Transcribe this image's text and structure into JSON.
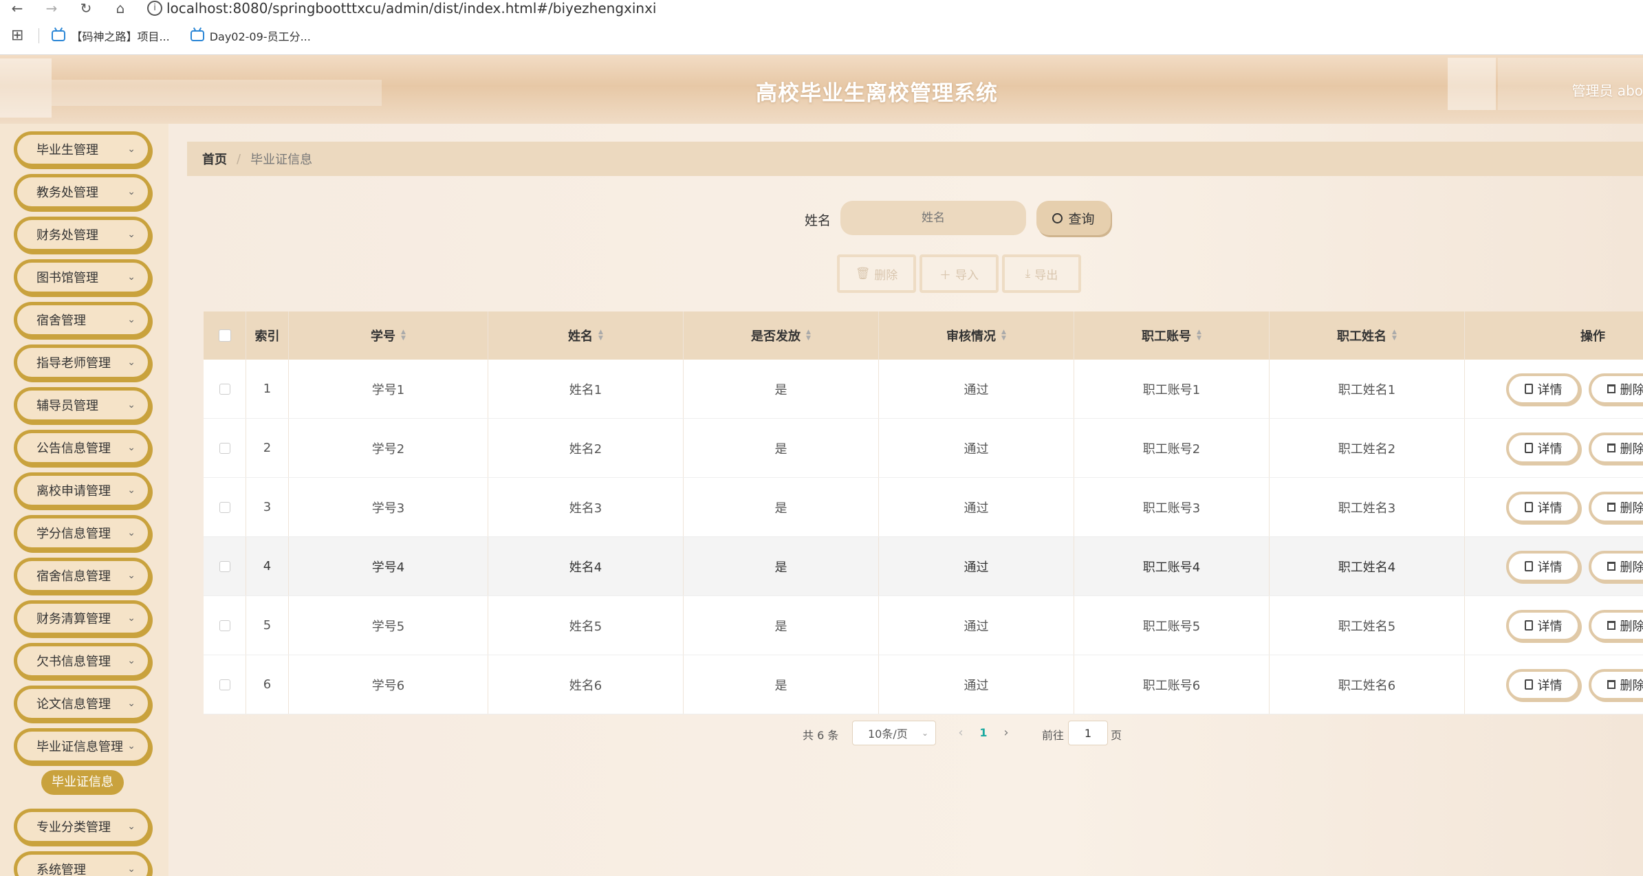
{
  "browser": {
    "url": "localhost:8080/springbootttxcu/admin/dist/index.html#/biyezhengxinxi",
    "bookmarks": [
      "【码神之路】项目...",
      "Day02-09-员工分..."
    ]
  },
  "header": {
    "title": "高校毕业生离校管理系统",
    "admin": "管理员 abo"
  },
  "sidebar": {
    "items": [
      {
        "label": "毕业生管理"
      },
      {
        "label": "教务处管理"
      },
      {
        "label": "财务处管理"
      },
      {
        "label": "图书馆管理"
      },
      {
        "label": "宿舍管理"
      },
      {
        "label": "指导老师管理"
      },
      {
        "label": "辅导员管理"
      },
      {
        "label": "公告信息管理"
      },
      {
        "label": "离校申请管理"
      },
      {
        "label": "学分信息管理"
      },
      {
        "label": "宿舍信息管理"
      },
      {
        "label": "财务清算管理"
      },
      {
        "label": "欠书信息管理"
      },
      {
        "label": "论文信息管理"
      },
      {
        "label": "毕业证信息管理"
      },
      {
        "label": "专业分类管理"
      },
      {
        "label": "系统管理"
      }
    ],
    "active_sub": "毕业证信息"
  },
  "breadcrumb": {
    "home": "首页",
    "sep": "/",
    "current": "毕业证信息"
  },
  "search": {
    "label": "姓名",
    "placeholder": "姓名",
    "button": "查询"
  },
  "actions": {
    "delete": "删除",
    "import": "导入",
    "export": "导出"
  },
  "table": {
    "headers": [
      "索引",
      "学号",
      "姓名",
      "是否发放",
      "审核情况",
      "职工账号",
      "职工姓名",
      "操作"
    ],
    "rows": [
      {
        "index": "1",
        "student_no": "学号1",
        "name": "姓名1",
        "issued": "是",
        "review": "通过",
        "staff_account": "职工账号1",
        "staff_name": "职工姓名1"
      },
      {
        "index": "2",
        "student_no": "学号2",
        "name": "姓名2",
        "issued": "是",
        "review": "通过",
        "staff_account": "职工账号2",
        "staff_name": "职工姓名2"
      },
      {
        "index": "3",
        "student_no": "学号3",
        "name": "姓名3",
        "issued": "是",
        "review": "通过",
        "staff_account": "职工账号3",
        "staff_name": "职工姓名3"
      },
      {
        "index": "4",
        "student_no": "学号4",
        "name": "姓名4",
        "issued": "是",
        "review": "通过",
        "staff_account": "职工账号4",
        "staff_name": "职工姓名4"
      },
      {
        "index": "5",
        "student_no": "学号5",
        "name": "姓名5",
        "issued": "是",
        "review": "通过",
        "staff_account": "职工账号5",
        "staff_name": "职工姓名5"
      },
      {
        "index": "6",
        "student_no": "学号6",
        "name": "姓名6",
        "issued": "是",
        "review": "通过",
        "staff_account": "职工账号6",
        "staff_name": "职工姓名6"
      }
    ],
    "op_detail": "详情",
    "op_delete": "删除"
  },
  "pagination": {
    "total": "共 6 条",
    "page_size": "10条/页",
    "current": "1",
    "goto": "前往",
    "goto_value": "1",
    "page_suffix": "页"
  },
  "colors": {
    "accent": "#c9a23d",
    "header_bg": "#ecd9bf",
    "page_link": "#1aa9a0"
  }
}
